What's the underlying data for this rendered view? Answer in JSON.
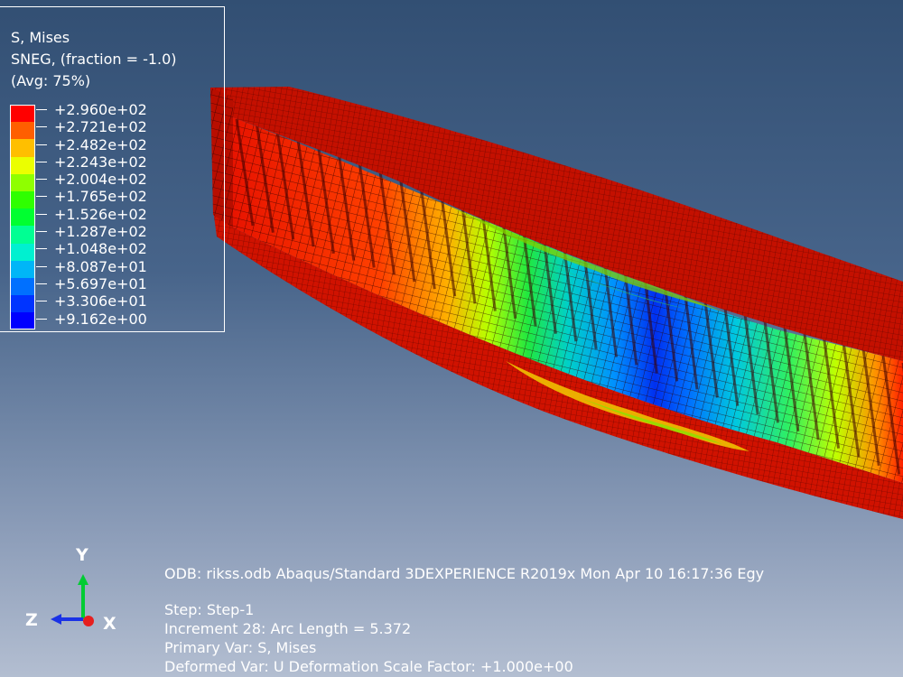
{
  "legend": {
    "title_line1": "S, Mises",
    "title_line2": "SNEG, (fraction = -1.0)",
    "title_line3": "(Avg: 75%)",
    "values": [
      "+2.960e+02",
      "+2.721e+02",
      "+2.482e+02",
      "+2.243e+02",
      "+2.004e+02",
      "+1.765e+02",
      "+1.526e+02",
      "+1.287e+02",
      "+1.048e+02",
      "+8.087e+01",
      "+5.697e+01",
      "+3.306e+01",
      "+9.162e+00"
    ],
    "colors": [
      "#ff0000",
      "#ff5f00",
      "#ffbf00",
      "#ebff00",
      "#8fff00",
      "#2fff00",
      "#00ff30",
      "#00ff93",
      "#00f0d0",
      "#00b6f7",
      "#0070ff",
      "#0034ff",
      "#0000ff"
    ]
  },
  "triad": {
    "y_label": "Y",
    "z_label": "Z",
    "x_label": "X",
    "y_color": "#00cc33",
    "z_color": "#1a32e6",
    "x_color": "#e61f1f"
  },
  "info": {
    "odb_line": "ODB: rikss.odb    Abaqus/Standard 3DEXPERIENCE R2019x    Mon Apr 10 16:17:36 Egy",
    "step_line": "Step: Step-1",
    "increment_line": "Increment     28: Arc Length =    5.372",
    "primary_line": "Primary Var: S, Mises",
    "deformed_line": "Deformed Var: U   Deformation Scale Factor: +1.000e+00"
  }
}
